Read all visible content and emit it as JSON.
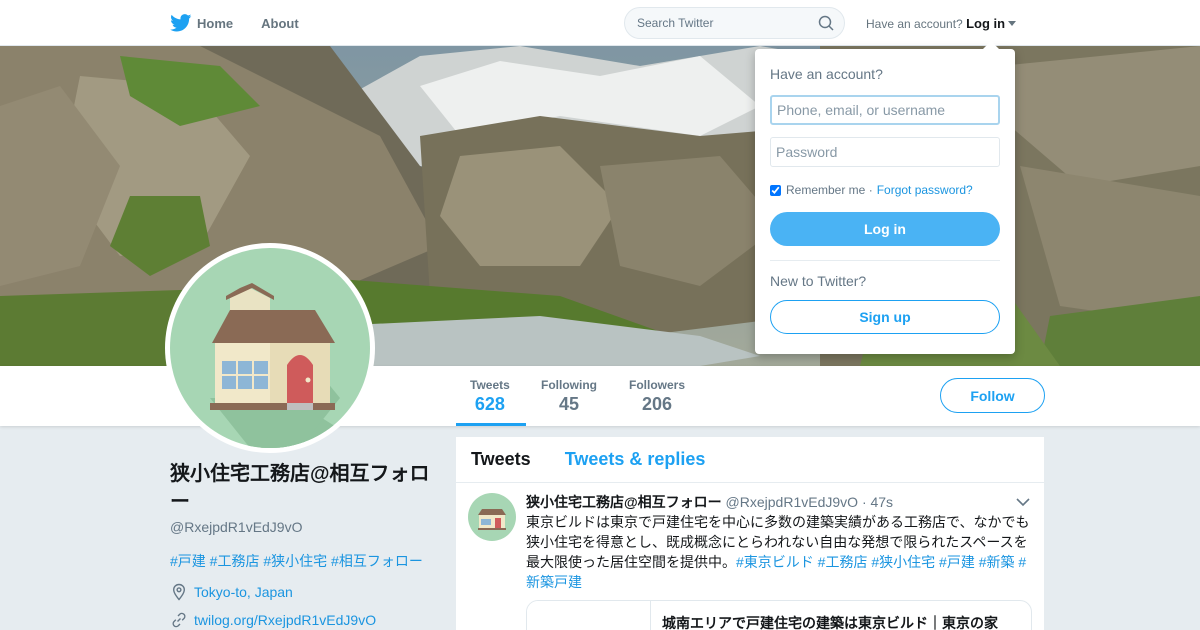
{
  "nav": {
    "home_label": "Home",
    "about_label": "About",
    "search_placeholder": "Search Twitter",
    "have_account": "Have an account?",
    "login_label": "Log in"
  },
  "profile": {
    "name": "狭小住宅工務店@相互フォロー",
    "handle": "@RxejpdR1vEdJ9vO",
    "hashtags": "#戸建 #工務店 #狭小住宅 #相互フォロー",
    "location": "Tokyo-to, Japan",
    "link": "twilog.org/RxejpdR1vEdJ9vO",
    "follow_label": "Follow"
  },
  "stats": [
    {
      "label": "Tweets",
      "value": "628"
    },
    {
      "label": "Following",
      "value": "45"
    },
    {
      "label": "Followers",
      "value": "206"
    }
  ],
  "timeline": {
    "tab_tweets": "Tweets",
    "tab_replies": "Tweets & replies",
    "tweet": {
      "name": "狭小住宅工務店@相互フォロー",
      "handle": "@RxejpdR1vEdJ9vO",
      "time": "· 47s",
      "text": "東京ビルドは東京で戸建住宅を中心に多数の建築実績がある工務店で、なかでも狭小住宅を得意とし、既成概念にとらわれない自由な発想で限られたスペースを最大限使った居住空間を提供中。",
      "hashtags": "#東京ビルド #工務店 #狭小住宅 #戸建 #新築 #新築戸建",
      "card_title": "城南エリアで戸建住宅の建築は東京ビルド｜東京の家"
    }
  },
  "login": {
    "title": "Have an account?",
    "username_placeholder": "Phone, email, or username",
    "password_placeholder": "Password",
    "remember": "Remember me ·",
    "forgot": "Forgot password?",
    "login_button": "Log in",
    "new_to": "New to Twitter?",
    "signup_button": "Sign up"
  },
  "colors": {
    "accent": "#1da1f2",
    "link": "#1b95e0",
    "avatar_bg": "#a7d6b4"
  }
}
